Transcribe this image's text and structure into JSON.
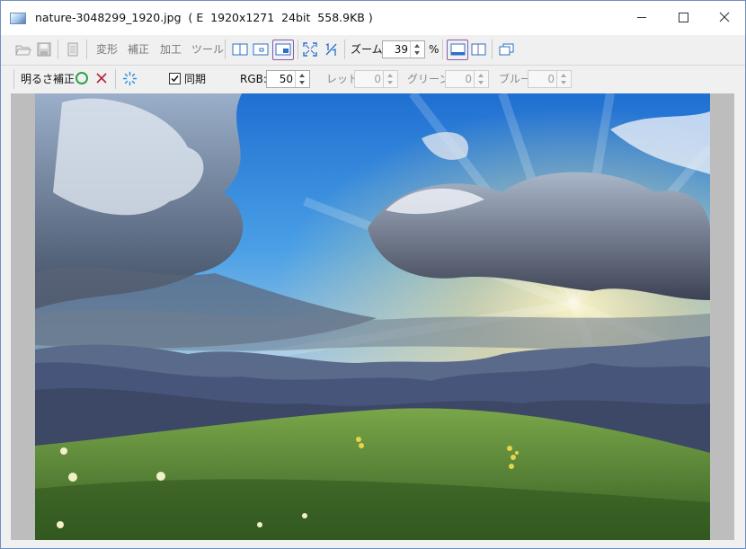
{
  "window": {
    "title": "nature-3048299_1920.jpg  ( E  1920x1271  24bit  558.9KB )"
  },
  "toolbar": {
    "menu_transform": "変形",
    "menu_correct": "補正",
    "menu_process": "加工",
    "menu_tools": "ツール",
    "zoom_label": "ズーム:",
    "zoom_value": "39",
    "zoom_unit": "%"
  },
  "adjust_bar": {
    "mode_label": "明るさ補正",
    "sync_label": "同期",
    "sync_checked": true,
    "rgb_label": "RGB:",
    "rgb_value": "50",
    "red_label": "レッド:",
    "red_value": "0",
    "green_label": "グリーン:",
    "green_value": "0",
    "blue_label": "ブルー:",
    "blue_value": "0"
  },
  "colors": {
    "accent": "#2a6fc9",
    "apply_green": "#2fa34a",
    "cancel_red": "#b0263a",
    "highlight": "#8b5aa8"
  },
  "image": {
    "description_icon": "landscape-photo"
  }
}
